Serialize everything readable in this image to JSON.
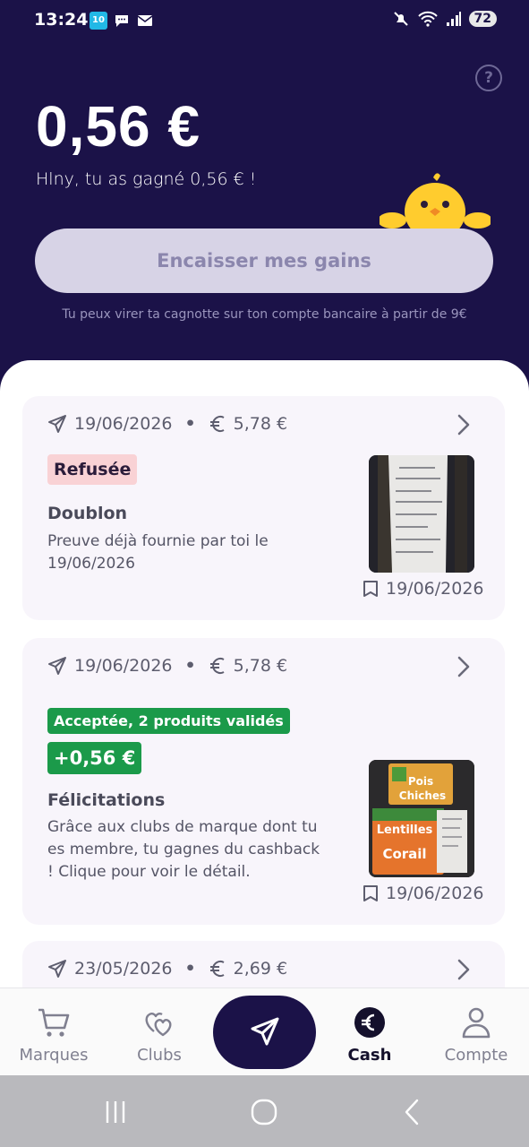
{
  "status_bar": {
    "time": "13:24",
    "notif_app_label": "10",
    "battery": "72"
  },
  "header": {
    "balance": "0,56 €",
    "earned_message": "Hlny, tu as gagné 0,56 € !",
    "cashout_label": "Encaisser mes gains",
    "transfer_info": "Tu peux virer ta cagnotte sur ton compte bancaire à partir de 9€"
  },
  "receipts": [
    {
      "date": "19/06/2026",
      "amount": "5,78 €",
      "status": "Refusée",
      "title": "Doublon",
      "description": "Preuve déjà fournie par toi le 19/06/2026",
      "receipt_date": "19/06/2026"
    },
    {
      "date": "19/06/2026",
      "amount": "5,78 €",
      "status": "Acceptée, 2 produits validés",
      "cashback": "+0,56 €",
      "title": "Félicitations",
      "description": "Grâce aux clubs de marque dont tu es membre, tu gagnes du cashback ! Clique pour voir le détail.",
      "receipt_date": "19/06/2026"
    },
    {
      "date": "23/05/2026",
      "amount": "2,69 €"
    }
  ],
  "bottom_nav": {
    "items": [
      {
        "label": "Marques",
        "icon": "cart-icon"
      },
      {
        "label": "Clubs",
        "icon": "hearts-icon"
      },
      {
        "label": "Cash",
        "icon": "euro-coin-icon"
      },
      {
        "label": "Compte",
        "icon": "person-icon"
      }
    ],
    "send_icon": "send-icon",
    "active": "Cash"
  },
  "colors": {
    "header_bg": "#1b1248",
    "refused_badge": "#f9d2d5",
    "accepted_badge": "#1b9a4a"
  }
}
